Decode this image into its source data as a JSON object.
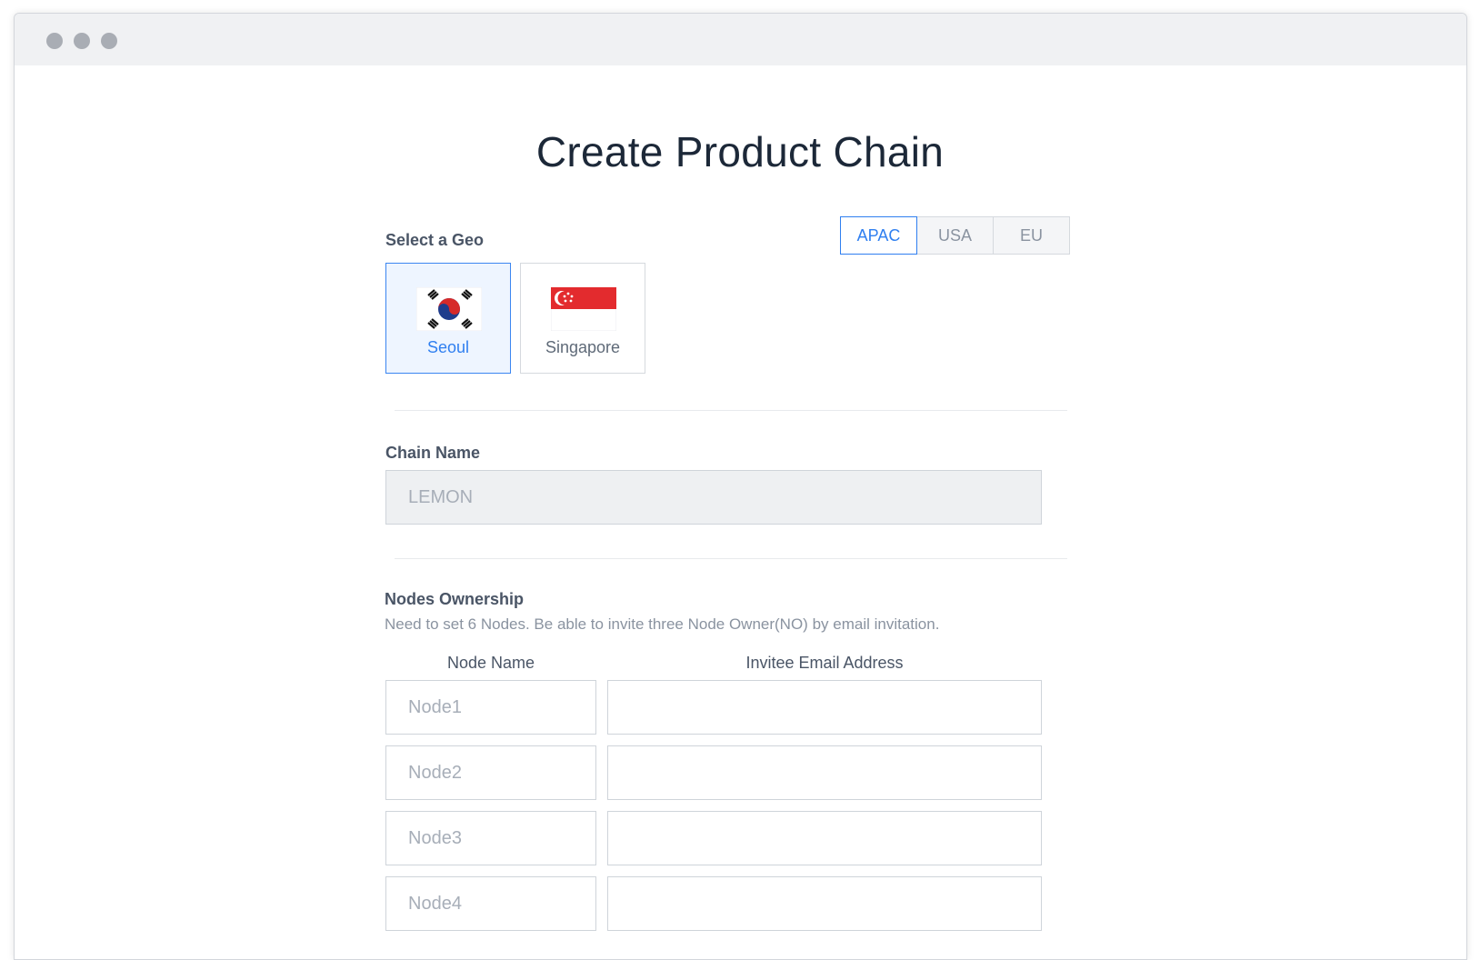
{
  "window": {
    "controls": [
      "close",
      "minimize",
      "maximize"
    ]
  },
  "page": {
    "title": "Create Product Chain"
  },
  "geo": {
    "label": "Select a Geo",
    "tabs": [
      {
        "label": "APAC",
        "active": true
      },
      {
        "label": "USA",
        "active": false
      },
      {
        "label": "EU",
        "active": false
      }
    ],
    "locations": [
      {
        "name": "Seoul",
        "flag": "south-korea-flag",
        "selected": true
      },
      {
        "name": "Singapore",
        "flag": "singapore-flag",
        "selected": false
      }
    ]
  },
  "chain_name": {
    "label": "Chain Name",
    "value": "LEMON"
  },
  "nodes": {
    "label": "Nodes Ownership",
    "help": "Need to set 6 Nodes. Be able to invite three Node Owner(NO) by email invitation.",
    "col_node_name": "Node Name",
    "col_email": "Invitee Email Address",
    "rows": [
      {
        "placeholder": "Node1",
        "email": ""
      },
      {
        "placeholder": "Node2",
        "email": ""
      },
      {
        "placeholder": "Node3",
        "email": ""
      },
      {
        "placeholder": "Node4",
        "email": ""
      }
    ]
  },
  "colors": {
    "accent": "#2f7ff0",
    "title": "#1c2838",
    "muted": "#8a93a0"
  }
}
